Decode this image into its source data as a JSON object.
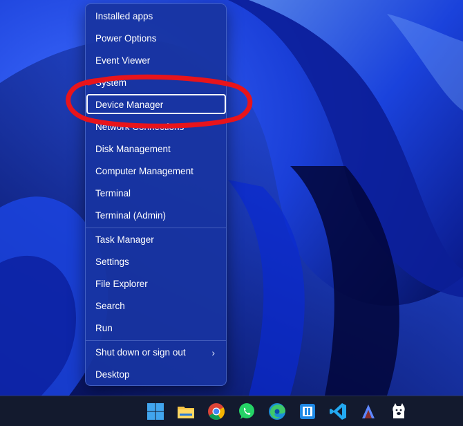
{
  "menu": {
    "groups": [
      [
        "Installed apps",
        "Power Options",
        "Event Viewer",
        "System",
        "Device Manager",
        "Network Connections",
        "Disk Management",
        "Computer Management",
        "Terminal",
        "Terminal (Admin)"
      ],
      [
        "Task Manager",
        "Settings",
        "File Explorer",
        "Search",
        "Run"
      ],
      [
        "Shut down or sign out",
        "Desktop"
      ]
    ],
    "selected_item": "Device Manager",
    "chevron": "›"
  },
  "annotation": {
    "shape": "hand-drawn-ellipse",
    "color": "#e8141b"
  },
  "taskbar": {
    "icons": [
      "windows-start-icon",
      "file-explorer-icon",
      "chrome-icon",
      "whatsapp-icon",
      "edge-icon",
      "terminal-icon",
      "vscode-icon",
      "app-a-icon",
      "alpaca-icon"
    ]
  },
  "colors": {
    "menu_bg": "#1834a0",
    "taskbar_bg": "#131a2e",
    "annotation": "#e8141b"
  }
}
